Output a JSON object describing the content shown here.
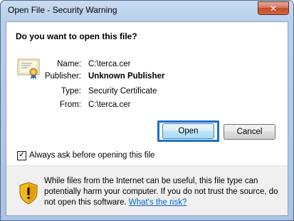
{
  "window": {
    "title": "Open File - Security Warning",
    "close_label": "✕"
  },
  "dialog": {
    "question": "Do you want to open this file?",
    "fields": [
      {
        "label": "Name:",
        "value": "C:\\terca.cer",
        "bold": false
      },
      {
        "label": "Publisher:",
        "value": "Unknown Publisher",
        "bold": true
      },
      {
        "label": "Type:",
        "value": "Security Certificate",
        "bold": false
      },
      {
        "label": "From:",
        "value": "C:\\terca.cer",
        "bold": false
      }
    ],
    "open_label": "Open",
    "cancel_label": "Cancel",
    "checkbox": {
      "label": "Always ask before opening this file",
      "checked": true,
      "mark": "✓"
    },
    "warning": {
      "text": "While files from the Internet can be useful, this file type can potentially harm your computer. If you do not trust the source, do not open this software.",
      "link": "What's the risk?"
    }
  },
  "colors": {
    "accent": "#1e6ec8",
    "link": "#0066cc",
    "close": "#c44a2c"
  }
}
